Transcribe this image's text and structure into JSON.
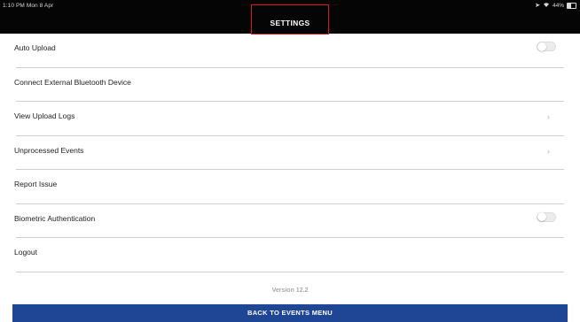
{
  "status_bar": {
    "time_date": "1:10 PM  Mon 8 Apr",
    "battery_text": "44%",
    "battery_level": 0.44,
    "icons": [
      "location-arrow-icon",
      "wifi-icon",
      "battery-icon"
    ]
  },
  "header": {
    "title": "SETTINGS",
    "highlight_color": "#e0161e",
    "background": "#050505"
  },
  "settings": {
    "items": [
      {
        "label": "Auto Upload",
        "control": "toggle",
        "value": "off"
      },
      {
        "label": "Connect External Bluetooth Device",
        "control": "none"
      },
      {
        "label": "View Upload Logs",
        "control": "chevron",
        "glyph": "›"
      },
      {
        "label": "Unprocessed Events",
        "control": "chevron",
        "glyph": "›"
      },
      {
        "label": "Report Issue",
        "control": "none"
      },
      {
        "label": "Biometric Authentication",
        "control": "toggle",
        "value": "off"
      },
      {
        "label": "Logout",
        "control": "none"
      }
    ]
  },
  "footer": {
    "version": "Version 12.2",
    "back_button_label": "BACK TO EVENTS MENU",
    "button_color": "#1f4595"
  }
}
